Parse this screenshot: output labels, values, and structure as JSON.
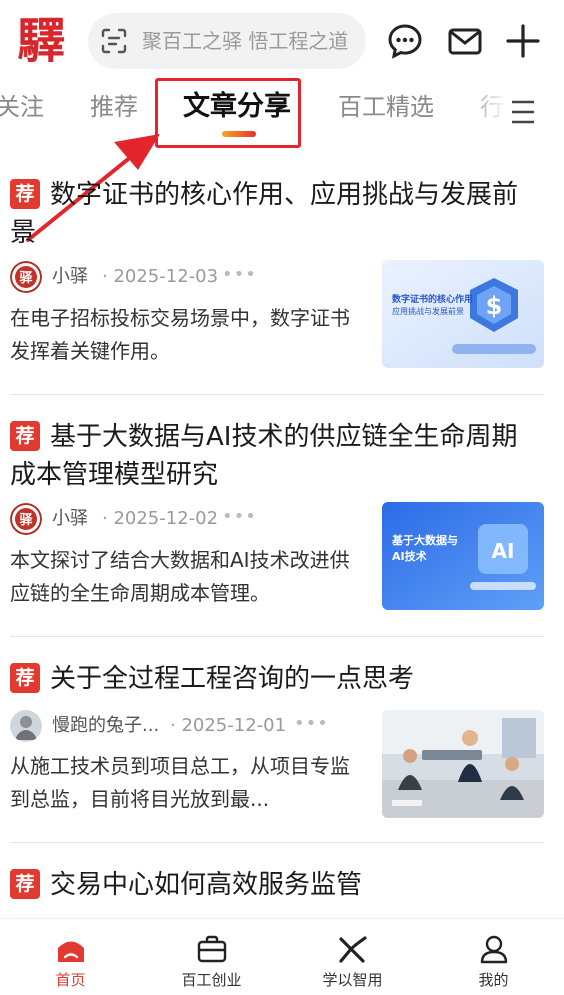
{
  "header": {
    "logo_char": "驛",
    "search_placeholder": "聚百工之驿 悟工程之道",
    "icons": [
      "scan-icon",
      "chat-icon",
      "mail-icon",
      "plus-icon"
    ]
  },
  "tabs": [
    {
      "label": "关注"
    },
    {
      "label": "推荐"
    },
    {
      "label": "文章分享",
      "active": true
    },
    {
      "label": "百工精选"
    },
    {
      "label": "行"
    }
  ],
  "articles": [
    {
      "badge": "荐",
      "title": "数字证书的核心作用、应用挑战与发展前景",
      "author": "小驿",
      "date": "2025-12-03",
      "summary": "在电子招标投标交易场景中，数字证书发挥着关键作用。",
      "thumb_title": "数字证书的核心作用",
      "thumb_sub": "应用挑战与发展前景"
    },
    {
      "badge": "荐",
      "title": "基于大数据与AI技术的供应链全生命周期成本管理模型研究",
      "author": "小驿",
      "date": "2025-12-02",
      "summary": "本文探讨了结合大数据和AI技术改进供应链的全生命周期成本管理。",
      "thumb_title": "基于大数据与",
      "thumb_sub": "AI技术"
    },
    {
      "badge": "荐",
      "title": "关于全过程工程咨询的一点思考",
      "author": "慢跑的兔子...",
      "date": "2025-12-01",
      "summary": "从施工技术员到项目总工，从项目专监到总监，目前将目光放到最..."
    },
    {
      "badge": "荐",
      "title": "交易中心如何高效服务监管"
    }
  ],
  "bottom_nav": [
    {
      "label": "首页",
      "active": true
    },
    {
      "label": "百工创业"
    },
    {
      "label": "学以智用"
    },
    {
      "label": "我的"
    }
  ],
  "colors": {
    "brand_red": "#e23a2e",
    "annotation_red": "#e3262c"
  }
}
